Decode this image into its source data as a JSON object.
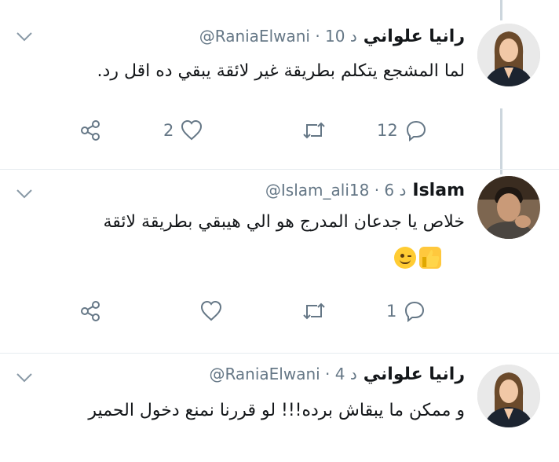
{
  "tweets": [
    {
      "name": "رانيا علواني",
      "handle_time": "@RaniaElwani · 10 د",
      "text": "لما المشجع يتكلم بطريقة غير لائقة يبقي ده اقل رد.",
      "replies": "12",
      "retweets": "",
      "likes": "2"
    },
    {
      "name": "Islam",
      "handle_time": "@Islam_ali18 · 6 د",
      "text": "خلاص يا جدعان المدرج هو الي هيبقي بطريقة لائقة",
      "emojis": [
        "thumbs-up",
        "winking-face"
      ],
      "replies": "1",
      "retweets": "",
      "likes": ""
    },
    {
      "name": "رانيا علواني",
      "handle_time": "@RaniaElwani · 4 د",
      "text": "و ممكن ما يبقاش برده!!! لو قررنا نمنع دخول الحمير"
    }
  ],
  "icons": {
    "reply": "reply-icon",
    "retweet": "retweet-icon",
    "like": "heart-icon",
    "share": "share-icon",
    "menu": "chevron-down-icon"
  },
  "colors": {
    "text": "#14171a",
    "muted": "#657786",
    "divider": "#e6ecf0",
    "thread_line": "#ccd6dd"
  }
}
